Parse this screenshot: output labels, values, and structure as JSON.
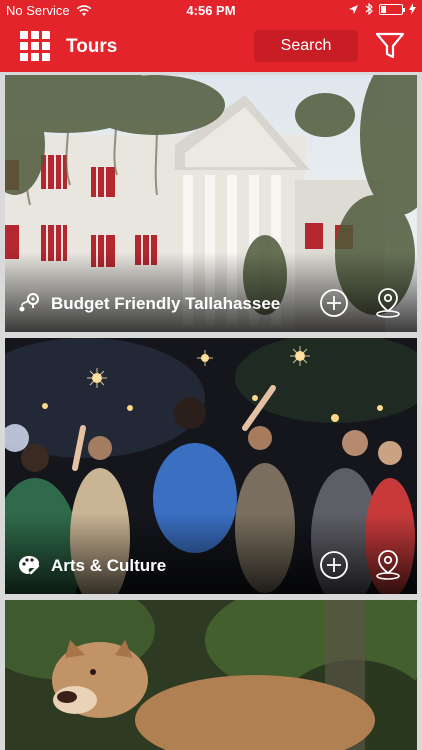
{
  "status": {
    "carrier": "No Service",
    "time": "4:56 PM"
  },
  "header": {
    "title": "Tours",
    "search_label": "Search",
    "menu_icon": "grid-menu-icon",
    "filter_icon": "filter-funnel-icon"
  },
  "colors": {
    "brand_red": "#e3242b",
    "search_bg": "#c81d24"
  },
  "tours": [
    {
      "title": "Budget Friendly Tallahassee",
      "icon": "map-pin-route-icon"
    },
    {
      "title": "Arts & Culture",
      "icon": "palette-icon"
    },
    {
      "title": "",
      "icon": ""
    }
  ]
}
